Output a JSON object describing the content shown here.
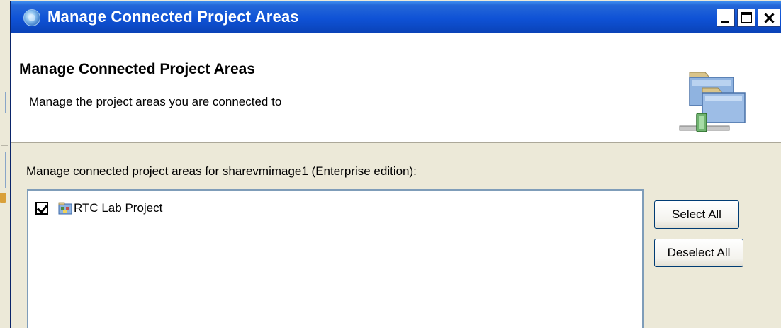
{
  "window": {
    "title": "Manage Connected Project Areas",
    "title_icon": "eclipse-dialog-icon",
    "controls": [
      "minimize",
      "maximize",
      "close"
    ]
  },
  "banner": {
    "heading": "Manage Connected Project Areas",
    "description": "Manage the project areas you are connected to",
    "icon": "connected-folders-icon"
  },
  "body": {
    "instruction": "Manage connected project areas for sharevmimage1 (Enterprise edition):",
    "project_areas": [
      {
        "label": "RTC Lab Project",
        "checked": true,
        "icon": "project-area-icon"
      }
    ]
  },
  "buttons": {
    "select_all": "Select All",
    "deselect_all": "Deselect All"
  },
  "colors": {
    "titlebar": "#0a43b8",
    "window_bg": "#ece9d8",
    "list_border": "#7f9db9",
    "button_border": "#003c74"
  }
}
